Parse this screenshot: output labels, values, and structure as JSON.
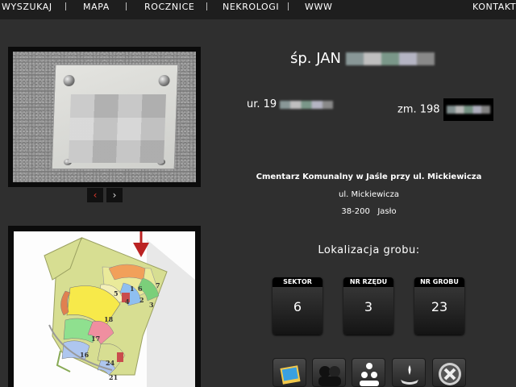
{
  "nav": {
    "items": [
      "WYSZUKAJ",
      "MAPA",
      "ROCZNICE",
      "NEKROLOGI",
      "WWW"
    ],
    "contact": "KONTAKT"
  },
  "person": {
    "name_prefix": "śp. JAN",
    "birth_prefix": "ur. 19",
    "death_prefix": "zm. 198"
  },
  "photo_pager": {
    "prev": "‹",
    "next": "›"
  },
  "cemetery": {
    "name": "Cmentarz Komunalny w Jaśle przy ul. Mickiewicza",
    "street": "ul. Mickiewicza",
    "city": "38-200   Jasło"
  },
  "location": {
    "title": "Lokalizacja grobu:",
    "sector_label": "SEKTOR",
    "sector": "6",
    "row_label": "NR RZĘDU",
    "row": "3",
    "grave_label": "NR GROBU",
    "grave": "23"
  },
  "map_labels": [
    "1",
    "2",
    "3",
    "4",
    "5",
    "6",
    "7",
    "18",
    "17",
    "16",
    "24",
    "21"
  ],
  "colors": {
    "accent_arrow": "#c0392b",
    "nav_bg": "#1e1e1e",
    "page_bg": "#2f2f2f"
  },
  "actions": [
    "photo-icon",
    "people-icon",
    "family-icon",
    "candle-icon",
    "close-icon"
  ]
}
